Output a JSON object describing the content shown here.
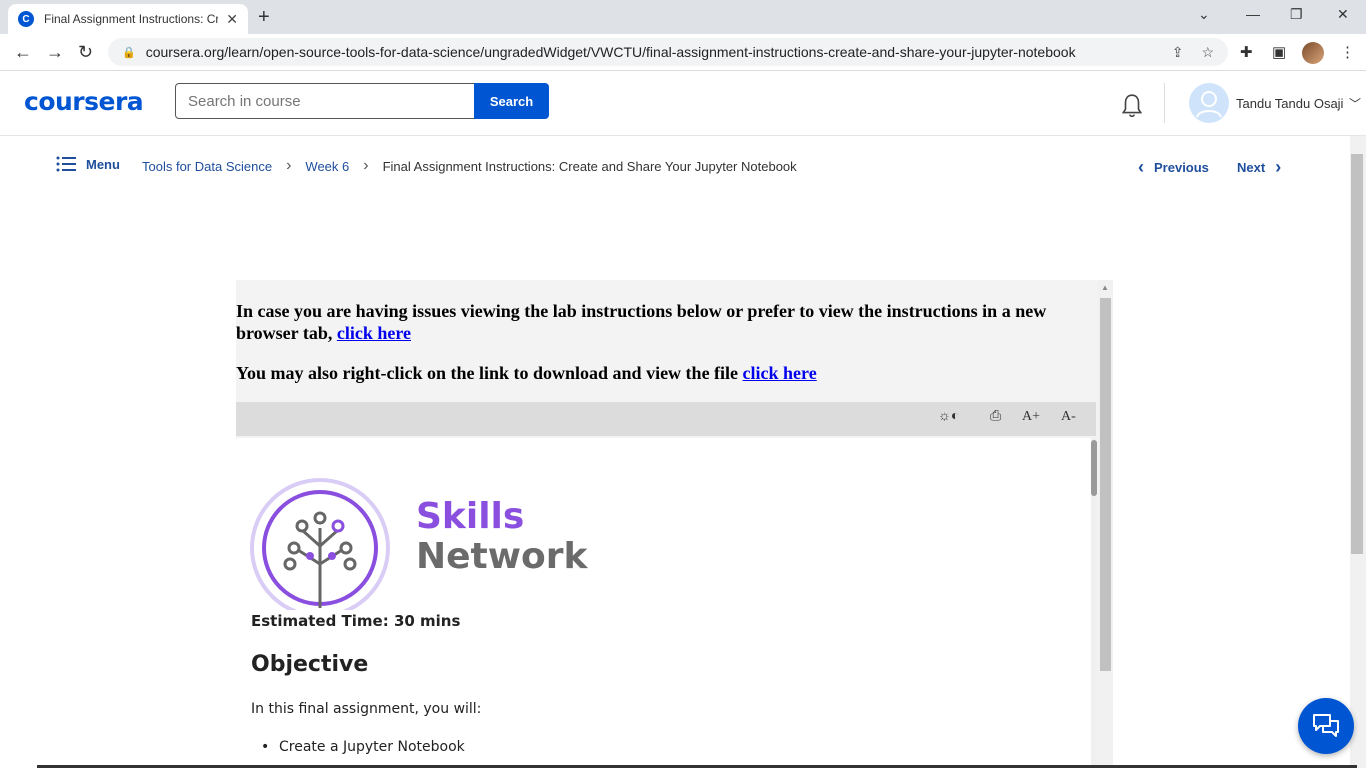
{
  "browser": {
    "tab_title": "Final Assignment Instructions: Cr",
    "favicon_letter": "C",
    "url": "coursera.org/learn/open-source-tools-for-data-science/ungradedWidget/VWCTU/final-assignment-instructions-create-and-share-your-jupyter-notebook"
  },
  "header": {
    "logo": "coursera",
    "search_placeholder": "Search in course",
    "search_button": "Search",
    "user_name": "Tandu Tandu Osaji"
  },
  "breadcrumb": {
    "menu_label": "Menu",
    "items": [
      "Tools for Data Science",
      "Week 6"
    ],
    "current": "Final Assignment Instructions: Create and Share Your Jupyter Notebook",
    "previous_label": "Previous",
    "next_label": "Next"
  },
  "lab": {
    "intro1_text": "In case you are having issues viewing the lab instructions below or prefer to view the instructions in a new browser tab,",
    "intro1_link": "click here",
    "intro2_text": "You may also right-click on the link to download and view the file",
    "intro2_link": "click here",
    "font_increase": "A+",
    "font_decrease": "A-",
    "brand_line1": "Skills",
    "brand_line2": "Network",
    "estimated_time": "Estimated Time: 30 mins",
    "objective_heading": "Objective",
    "objective_intro": "In this final assignment, you will:",
    "objective_items": [
      "Create a Jupyter Notebook"
    ]
  },
  "colors": {
    "brand_blue": "#0056d2",
    "link_blue": "#1f4e9c",
    "skills_purple": "#8a4fdf"
  }
}
